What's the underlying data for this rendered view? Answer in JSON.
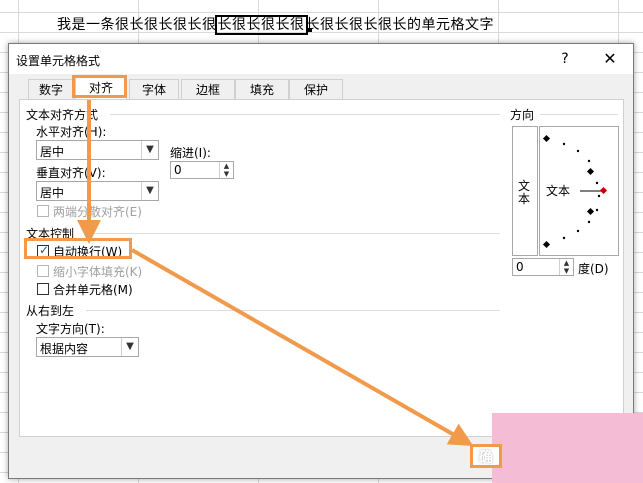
{
  "sheet": {
    "cell_text_prefix": "我是一条很长很长很长很",
    "cell_text_highlight": "长很长很长很",
    "cell_text_suffix": "长很长很长很长的单元格文字"
  },
  "dialog": {
    "title": "设置单元格格式",
    "help": "?",
    "close": "✕",
    "tabs": [
      "数字",
      "对齐",
      "字体",
      "边框",
      "填充",
      "保护"
    ]
  },
  "alignment": {
    "section": "文本对齐方式",
    "horizontal_label": "水平对齐(H):",
    "horizontal_value": "居中",
    "indent_label": "缩进(I):",
    "indent_value": "0",
    "vertical_label": "垂直对齐(V):",
    "vertical_value": "居中",
    "distributed_label": "两端分散对齐(E)"
  },
  "text_control": {
    "section": "文本控制",
    "wrap_label": "自动换行(W)",
    "wrap_checked": true,
    "shrink_label": "缩小字体填充(K)",
    "merge_label": "合并单元格(M)"
  },
  "rtl": {
    "section": "从右到左",
    "direction_label": "文字方向(T):",
    "direction_value": "根据内容"
  },
  "orientation": {
    "section": "方向",
    "vertical_text": "文本",
    "dial_text": "文本",
    "degree_value": "0",
    "degree_label": "度(D)"
  },
  "ok_fragment": "确"
}
